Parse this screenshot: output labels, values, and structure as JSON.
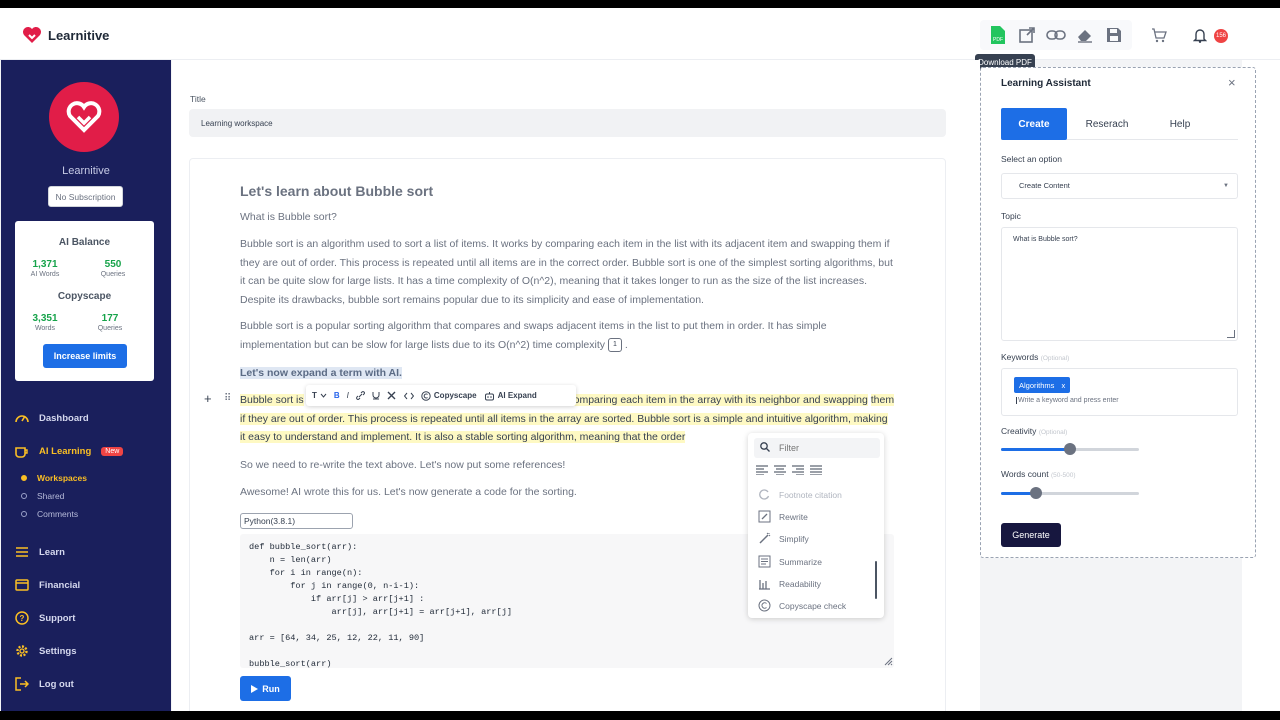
{
  "app": {
    "name": "Learnitive",
    "brand_color": "#e11d48"
  },
  "header": {
    "tooltip": "Download PDF",
    "pdf_badge": "PDF",
    "notification_count": "156",
    "icons": [
      "pdf-download-icon",
      "external-link-icon",
      "link-icon",
      "eraser-icon",
      "save-icon",
      "cart-icon",
      "bell-icon"
    ]
  },
  "sidebar": {
    "brand_name": "Learnitive",
    "subscription": "No Subscription",
    "balance": {
      "title": "AI Balance",
      "ai_words_value": "1,371",
      "ai_words_label": "AI Words",
      "queries_value": "550",
      "queries_label": "Queries",
      "copyscape_title": "Copyscape",
      "words_value": "3,351",
      "words_label": "Words",
      "cs_queries_value": "177",
      "cs_queries_label": "Queries",
      "increase_label": "Increase limits"
    },
    "nav": {
      "dashboard": "Dashboard",
      "ai_learning": "AI Learning",
      "new_tag": "New",
      "workspaces": "Workspaces",
      "shared": "Shared",
      "comments": "Comments",
      "learn": "Learn",
      "financial": "Financial",
      "support": "Support",
      "settings": "Settings",
      "logout": "Log out"
    }
  },
  "main": {
    "title_label": "Title",
    "title_value": "Learning workspace",
    "doc": {
      "heading": "Let's learn about Bubble sort",
      "question": "What is Bubble sort?",
      "para1": "Bubble sort is an algorithm used to sort a list of items. It works by comparing each item in the list with its adjacent item and swapping them if they are out of order. This process is repeated until all items are in the correct order. Bubble sort is one of the simplest sorting algorithms, but it can be quite slow for large lists. It has a time complexity of O(n^2), meaning that it takes longer to run as the size of the list increases. Despite its drawbacks, bubble sort remains popular due to its simplicity and ease of implementation.",
      "para2": "Bubble sort is a popular sorting algorithm that compares and swaps adjacent items in the list to put them in order. It has simple implementation but can be slow for large lists due to its O(n^2) time complexity",
      "footnote_num": "1",
      "para2_end": ".",
      "highlight": "Let's now expand a term with AI.",
      "yellow_start": "Bubble sort is",
      "yellow_mid": "omparing each item in the array with its neighbor and swapping",
      "yellow_rest": "them if they are out of order. This process is repeated until all items in the array are sorted. Bubble sort is a simple and intuitive algorithm, making it easy to understand and implement. It is also a stable sorting algorithm, meaning that the order",
      "para3": "So we need to re-write the text above. Let's now put some references!",
      "para4": "Awesome! AI wrote this for us. Let's now generate a code for the sorting."
    },
    "toolbar": {
      "t": "T",
      "bold": "B",
      "italic": "I",
      "copyscape": "Copyscape",
      "ai_expand": "AI Expand"
    },
    "code_lang": "Python(3.8.1)",
    "code": "def bubble_sort(arr):\n    n = len(arr)\n    for i in range(n):\n        for j in range(0, n-i-1):\n            if arr[j] > arr[j+1] :\n                arr[j], arr[j+1] = arr[j+1], arr[j]\n\narr = [64, 34, 25, 12, 22, 11, 90]\n\nbubble_sort(arr)",
    "run_label": "Run"
  },
  "ai_menu": {
    "filter_placeholder": "Filter",
    "items": [
      "Footnote citation",
      "Rewrite",
      "Simplify",
      "Summarize",
      "Readability",
      "Copyscape check"
    ]
  },
  "assistant": {
    "title": "Learning Assistant",
    "close": "×",
    "tabs": [
      "Create",
      "Reserach",
      "Help"
    ],
    "select_label": "Select an option",
    "select_value": "Create Content",
    "topic_label": "Topic",
    "topic_value": "What is Bubble sort?",
    "keywords_label": "Keywords",
    "optional": "(Optional)",
    "keyword_chip": "Algorithms",
    "chip_x": "x",
    "keyword_placeholder": "Write a keyword and press enter",
    "creativity_label": "Creativity",
    "creativity_level": 0.5,
    "words_label": "Words count",
    "words_range": "(50-500)",
    "words_level": 0.25,
    "generate_label": "Generate"
  }
}
